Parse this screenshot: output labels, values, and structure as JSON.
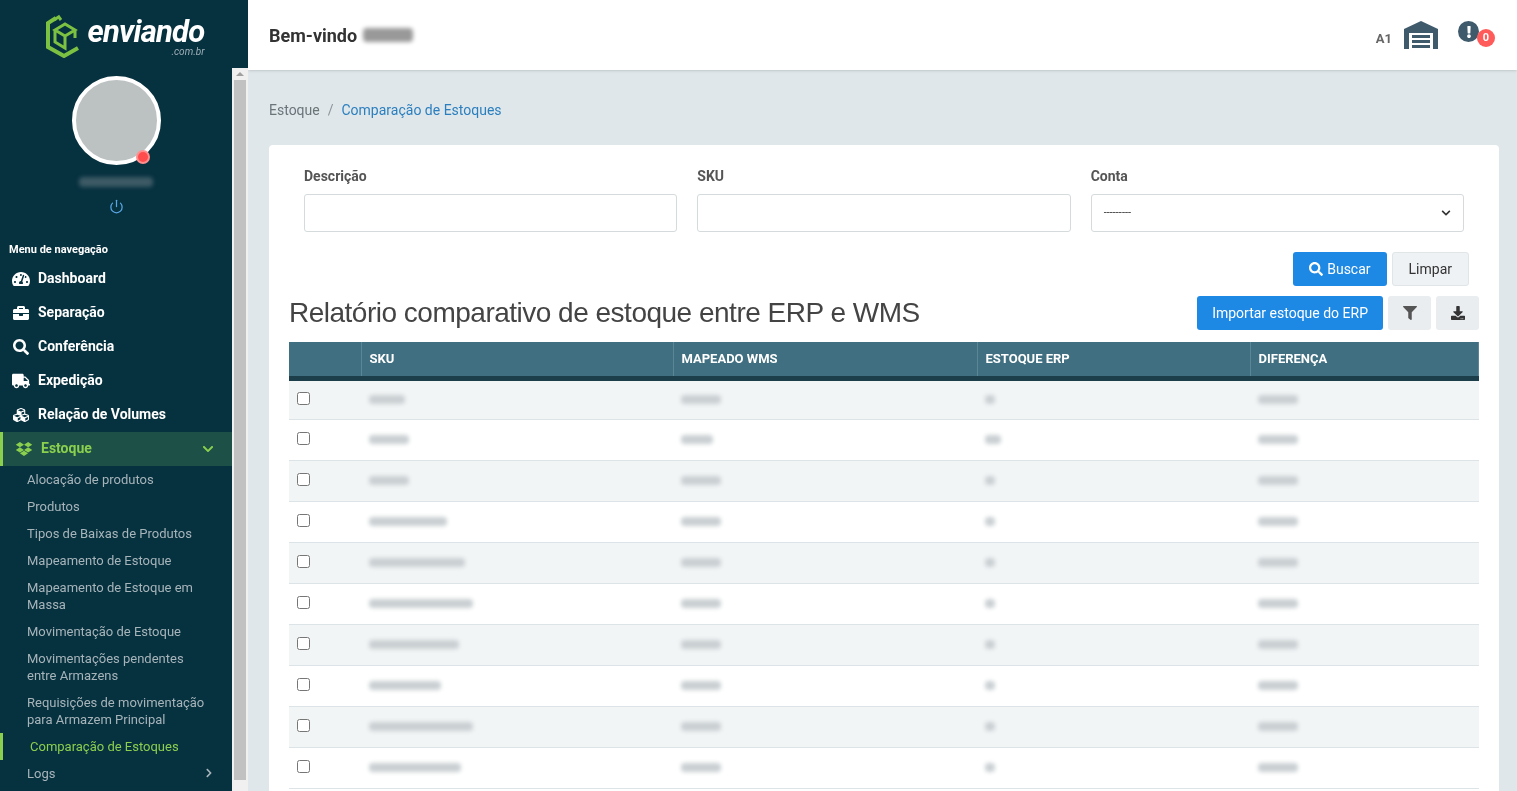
{
  "brand": {
    "name": "enviando",
    "domain": ".com.br"
  },
  "sidebar": {
    "menu_title": "Menu de navegação",
    "items": [
      {
        "label": "Dashboard",
        "kind": "link",
        "selected": false
      },
      {
        "label": "Separação",
        "kind": "link",
        "selected": false
      },
      {
        "label": "Conferência",
        "kind": "link",
        "selected": false
      },
      {
        "label": "Expedição",
        "kind": "link",
        "selected": false
      },
      {
        "label": "Relação de Volumes",
        "kind": "link",
        "selected": false
      },
      {
        "label": "Estoque",
        "kind": "group",
        "selected": true,
        "expanded": true,
        "children": [
          {
            "label": "Alocação de produtos",
            "kind": "link",
            "selected": false
          },
          {
            "label": "Produtos",
            "kind": "link",
            "selected": false
          },
          {
            "label": "Tipos de Baixas de Produtos",
            "kind": "link",
            "selected": false
          },
          {
            "label": "Mapeamento de Estoque",
            "kind": "link",
            "selected": false
          },
          {
            "label": "Mapeamento de Estoque em Massa",
            "kind": "link",
            "selected": false
          },
          {
            "label": "Movimentação de Estoque",
            "kind": "link",
            "selected": false
          },
          {
            "label": "Movimentações pendentes entre Armazens",
            "kind": "link",
            "selected": false
          },
          {
            "label": "Requisições de movimentação para Armazem Principal",
            "kind": "link",
            "selected": false
          },
          {
            "label": "Comparação de Estoques",
            "kind": "link",
            "selected": true
          },
          {
            "label": "Logs",
            "kind": "group",
            "selected": false,
            "expanded": false
          }
        ]
      }
    ]
  },
  "header": {
    "greeting": "Bem-vindo",
    "warehouse_code": "A1",
    "alert_count": "0"
  },
  "breadcrumb": [
    {
      "label": "Estoque",
      "current": false
    },
    {
      "label": "Comparação de Estoques",
      "current": true
    }
  ],
  "breadcrumb_separator": "/",
  "filters": [
    {
      "label": "Descrição",
      "kind": "text"
    },
    {
      "label": "SKU",
      "kind": "text"
    },
    {
      "label": "Conta",
      "kind": "select",
      "value": "---------"
    }
  ],
  "filter_buttons": [
    {
      "label": "Buscar",
      "kind": "primary"
    },
    {
      "label": "Limpar",
      "kind": "secondary"
    }
  ],
  "report": {
    "title": "Relatório comparativo de estoque entre ERP e WMS",
    "import_button": "Importar estoque do ERP"
  },
  "table": {
    "columns": [
      "SKU",
      "MAPEADO WMS",
      "ESTOQUE ERP",
      "DIFERENÇA"
    ],
    "rows": [
      {
        "checked": false
      },
      {
        "checked": false
      },
      {
        "checked": false
      },
      {
        "checked": false
      },
      {
        "checked": false
      },
      {
        "checked": false
      },
      {
        "checked": false
      },
      {
        "checked": false
      },
      {
        "checked": false
      },
      {
        "checked": false
      }
    ]
  }
}
